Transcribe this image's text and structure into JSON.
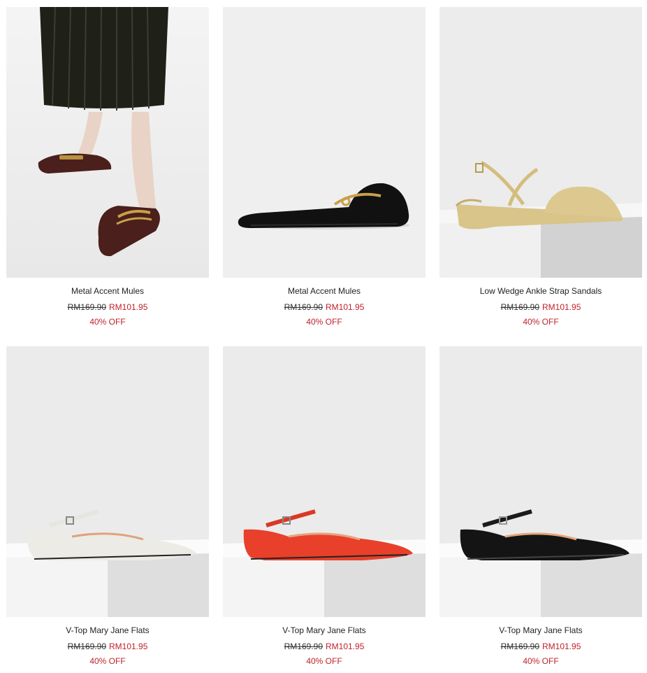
{
  "products": [
    {
      "name": "Metal Accent Mules",
      "old_price": "RM169.90",
      "new_price": "RM101.95",
      "discount": "40% OFF",
      "color": "#4a1f1c"
    },
    {
      "name": "Metal Accent Mules",
      "old_price": "RM169.90",
      "new_price": "RM101.95",
      "discount": "40% OFF",
      "color": "#111111"
    },
    {
      "name": "Low Wedge Ankle Strap Sandals",
      "old_price": "RM169.90",
      "new_price": "RM101.95",
      "discount": "40% OFF",
      "color": "#d9c48a"
    },
    {
      "name": "V-Top Mary Jane Flats",
      "old_price": "RM169.90",
      "new_price": "RM101.95",
      "discount": "40% OFF",
      "color": "#ecebe6"
    },
    {
      "name": "V-Top Mary Jane Flats",
      "old_price": "RM169.90",
      "new_price": "RM101.95",
      "discount": "40% OFF",
      "color": "#e8402a"
    },
    {
      "name": "V-Top Mary Jane Flats",
      "old_price": "RM169.90",
      "new_price": "RM101.95",
      "discount": "40% OFF",
      "color": "#141414"
    }
  ],
  "theme": {
    "sale_color": "#c0222b",
    "text_color": "#222222"
  }
}
